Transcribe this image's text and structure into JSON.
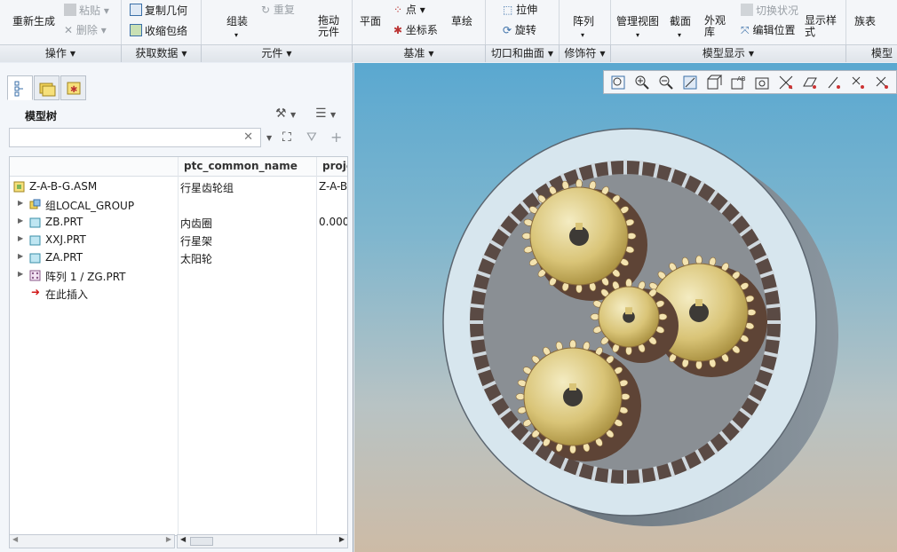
{
  "ribbon": {
    "regenerate": "重新生成",
    "paste": "粘贴",
    "delete": "删除",
    "copy_geom": "复制几何",
    "shrinkwrap": "收缩包络",
    "group": "组装",
    "redo": "重复",
    "drag": "拖动元件",
    "plane": "平面",
    "point": "点",
    "csys": "坐标系",
    "sketch": "草绘",
    "extrude": "拉伸",
    "revolve": "旋转",
    "pattern": "阵列",
    "manage_views": "管理视图",
    "section": "截面",
    "appearance": "外观库",
    "toggle_status": "切换状况",
    "edit_position": "编辑位置",
    "display_style": "显示样式",
    "family_table": "族表"
  },
  "groups": [
    {
      "label": "操作"
    },
    {
      "label": "获取数据"
    },
    {
      "label": "元件"
    },
    {
      "label": "基准"
    },
    {
      "label": "切口和曲面"
    },
    {
      "label": "修饰符"
    },
    {
      "label": "模型显示"
    },
    {
      "label": "模型意"
    }
  ],
  "tree": {
    "title": "模型树",
    "search_value": "",
    "columns": [
      "ptc_common_name",
      "proje"
    ],
    "rows": [
      {
        "name": "Z-A-B-G.ASM",
        "common": "行星齿轮组",
        "proj": "Z-A-B"
      },
      {
        "name": "组LOCAL_GROUP",
        "common": "",
        "proj": ""
      },
      {
        "name": "ZB.PRT",
        "common": "内齿圈",
        "proj": "0.000"
      },
      {
        "name": "XXJ.PRT",
        "common": "行星架",
        "proj": ""
      },
      {
        "name": "ZA.PRT",
        "common": "太阳轮",
        "proj": ""
      },
      {
        "name": "阵列 1 / ZG.PRT",
        "common": "",
        "proj": ""
      },
      {
        "name": "在此插入",
        "common": "",
        "proj": ""
      }
    ]
  },
  "colors": {
    "background_top": "#5aa8d0",
    "background_bottom": "#cdbba6",
    "ring_face": "#d7e6ee",
    "gear_gold": "#d9c477",
    "gear_teeth": "#6a4b3b"
  }
}
